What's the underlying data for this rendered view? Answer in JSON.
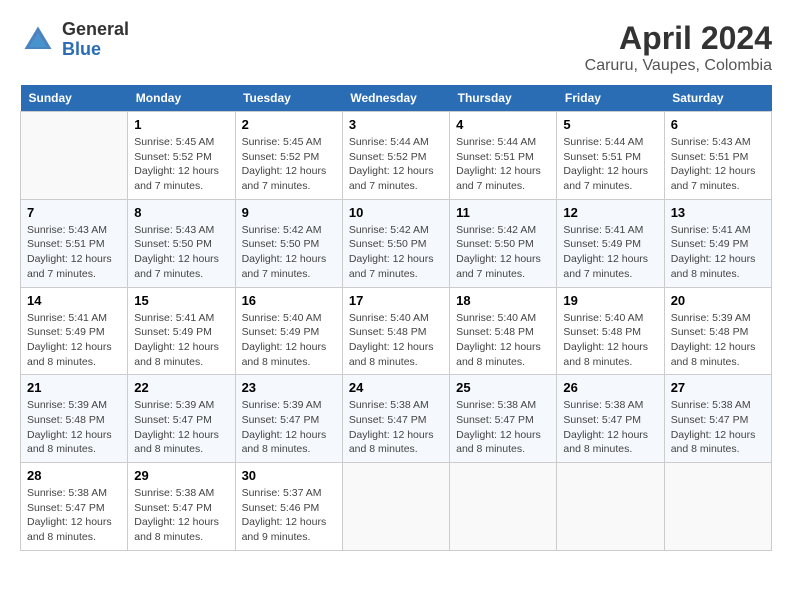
{
  "header": {
    "logo_line1": "General",
    "logo_line2": "Blue",
    "title": "April 2024",
    "subtitle": "Caruru, Vaupes, Colombia"
  },
  "calendar": {
    "days_of_week": [
      "Sunday",
      "Monday",
      "Tuesday",
      "Wednesday",
      "Thursday",
      "Friday",
      "Saturday"
    ],
    "weeks": [
      [
        {
          "day": null
        },
        {
          "day": "1",
          "sunrise": "5:45 AM",
          "sunset": "5:52 PM",
          "daylight": "12 hours and 7 minutes."
        },
        {
          "day": "2",
          "sunrise": "5:45 AM",
          "sunset": "5:52 PM",
          "daylight": "12 hours and 7 minutes."
        },
        {
          "day": "3",
          "sunrise": "5:44 AM",
          "sunset": "5:52 PM",
          "daylight": "12 hours and 7 minutes."
        },
        {
          "day": "4",
          "sunrise": "5:44 AM",
          "sunset": "5:51 PM",
          "daylight": "12 hours and 7 minutes."
        },
        {
          "day": "5",
          "sunrise": "5:44 AM",
          "sunset": "5:51 PM",
          "daylight": "12 hours and 7 minutes."
        },
        {
          "day": "6",
          "sunrise": "5:43 AM",
          "sunset": "5:51 PM",
          "daylight": "12 hours and 7 minutes."
        }
      ],
      [
        {
          "day": "7",
          "sunrise": "5:43 AM",
          "sunset": "5:51 PM",
          "daylight": "12 hours and 7 minutes."
        },
        {
          "day": "8",
          "sunrise": "5:43 AM",
          "sunset": "5:50 PM",
          "daylight": "12 hours and 7 minutes."
        },
        {
          "day": "9",
          "sunrise": "5:42 AM",
          "sunset": "5:50 PM",
          "daylight": "12 hours and 7 minutes."
        },
        {
          "day": "10",
          "sunrise": "5:42 AM",
          "sunset": "5:50 PM",
          "daylight": "12 hours and 7 minutes."
        },
        {
          "day": "11",
          "sunrise": "5:42 AM",
          "sunset": "5:50 PM",
          "daylight": "12 hours and 7 minutes."
        },
        {
          "day": "12",
          "sunrise": "5:41 AM",
          "sunset": "5:49 PM",
          "daylight": "12 hours and 7 minutes."
        },
        {
          "day": "13",
          "sunrise": "5:41 AM",
          "sunset": "5:49 PM",
          "daylight": "12 hours and 8 minutes."
        }
      ],
      [
        {
          "day": "14",
          "sunrise": "5:41 AM",
          "sunset": "5:49 PM",
          "daylight": "12 hours and 8 minutes."
        },
        {
          "day": "15",
          "sunrise": "5:41 AM",
          "sunset": "5:49 PM",
          "daylight": "12 hours and 8 minutes."
        },
        {
          "day": "16",
          "sunrise": "5:40 AM",
          "sunset": "5:49 PM",
          "daylight": "12 hours and 8 minutes."
        },
        {
          "day": "17",
          "sunrise": "5:40 AM",
          "sunset": "5:48 PM",
          "daylight": "12 hours and 8 minutes."
        },
        {
          "day": "18",
          "sunrise": "5:40 AM",
          "sunset": "5:48 PM",
          "daylight": "12 hours and 8 minutes."
        },
        {
          "day": "19",
          "sunrise": "5:40 AM",
          "sunset": "5:48 PM",
          "daylight": "12 hours and 8 minutes."
        },
        {
          "day": "20",
          "sunrise": "5:39 AM",
          "sunset": "5:48 PM",
          "daylight": "12 hours and 8 minutes."
        }
      ],
      [
        {
          "day": "21",
          "sunrise": "5:39 AM",
          "sunset": "5:48 PM",
          "daylight": "12 hours and 8 minutes."
        },
        {
          "day": "22",
          "sunrise": "5:39 AM",
          "sunset": "5:47 PM",
          "daylight": "12 hours and 8 minutes."
        },
        {
          "day": "23",
          "sunrise": "5:39 AM",
          "sunset": "5:47 PM",
          "daylight": "12 hours and 8 minutes."
        },
        {
          "day": "24",
          "sunrise": "5:38 AM",
          "sunset": "5:47 PM",
          "daylight": "12 hours and 8 minutes."
        },
        {
          "day": "25",
          "sunrise": "5:38 AM",
          "sunset": "5:47 PM",
          "daylight": "12 hours and 8 minutes."
        },
        {
          "day": "26",
          "sunrise": "5:38 AM",
          "sunset": "5:47 PM",
          "daylight": "12 hours and 8 minutes."
        },
        {
          "day": "27",
          "sunrise": "5:38 AM",
          "sunset": "5:47 PM",
          "daylight": "12 hours and 8 minutes."
        }
      ],
      [
        {
          "day": "28",
          "sunrise": "5:38 AM",
          "sunset": "5:47 PM",
          "daylight": "12 hours and 8 minutes."
        },
        {
          "day": "29",
          "sunrise": "5:38 AM",
          "sunset": "5:47 PM",
          "daylight": "12 hours and 8 minutes."
        },
        {
          "day": "30",
          "sunrise": "5:37 AM",
          "sunset": "5:46 PM",
          "daylight": "12 hours and 9 minutes."
        },
        {
          "day": null
        },
        {
          "day": null
        },
        {
          "day": null
        },
        {
          "day": null
        }
      ]
    ]
  }
}
